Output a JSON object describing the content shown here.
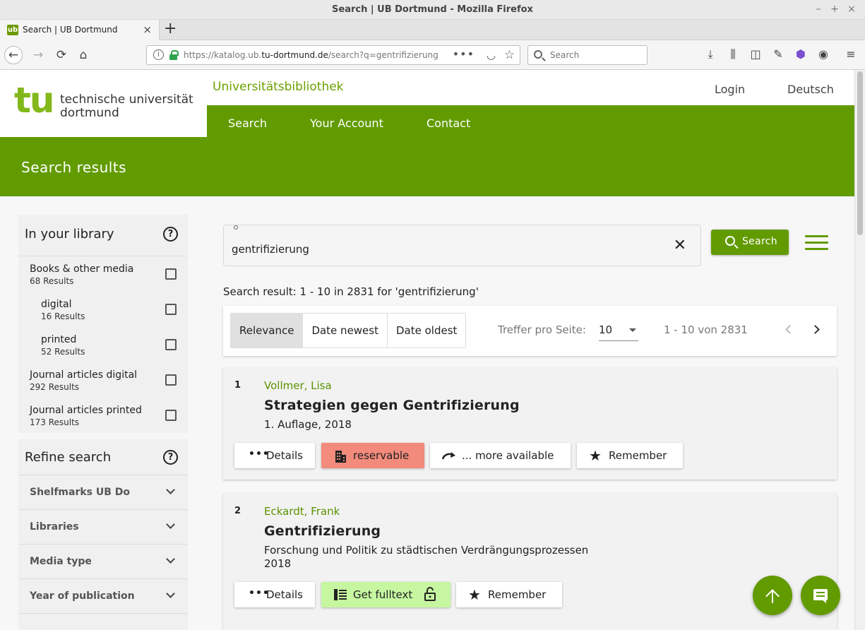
{
  "window": {
    "title": "Search | UB Dortmund - Mozilla Firefox",
    "controls": [
      "–",
      "+",
      "×"
    ]
  },
  "tab": {
    "favicon_text": "ub",
    "label": "Search | UB Dortmund",
    "close": "×",
    "new_tab": "+"
  },
  "urlbar": {
    "prefix": "https://katalog.ub.",
    "domain": "tu-dortmund.de",
    "suffix": "/search?q=gentrifizierung",
    "info": "i",
    "dots": "•••"
  },
  "browser_search": {
    "placeholder": "Search"
  },
  "site": {
    "logo_mark": "tu",
    "logo_line1": "technische universität",
    "logo_line2": "dortmund",
    "library_name": "Universitätsbibliothek",
    "login": "Login",
    "language": "Deutsch",
    "nav": [
      "Search",
      "Your Account",
      "Contact"
    ],
    "page_title": "Search results"
  },
  "sidebar": {
    "library_title": "In your library",
    "facets": [
      {
        "label": "Books & other media",
        "count": "68 Results"
      },
      {
        "label": "digital",
        "count": "16 Results"
      },
      {
        "label": "printed",
        "count": "52 Results"
      },
      {
        "label": "Journal articles digital",
        "count": "292 Results"
      },
      {
        "label": "Journal articles printed",
        "count": "173 Results"
      }
    ],
    "refine_title": "Refine search",
    "refine_items": [
      "Shelfmarks UB Do",
      "Libraries",
      "Media type",
      "Year of publication"
    ],
    "help": "?"
  },
  "search": {
    "query": "gentrifizierung",
    "button": "Search",
    "clear": "✕"
  },
  "result_summary": "Search result: 1 - 10 in 2831 for 'gentrifizierung'",
  "sort": {
    "options": [
      "Relevance",
      "Date newest",
      "Date oldest"
    ],
    "active": "Relevance",
    "per_page_label": "Treffer pro Seite:",
    "per_page_value": "10",
    "range": "1 - 10 von 2831"
  },
  "results": [
    {
      "num": "1",
      "author": "Vollmer, Lisa",
      "title": "Strategien gegen Gentrifizierung",
      "meta": [
        "1. Auflage, 2018"
      ],
      "actions": [
        "Details",
        "reservable",
        "... more available",
        "Remember"
      ]
    },
    {
      "num": "2",
      "author": "Eckardt, Frank",
      "title": "Gentrifizierung",
      "meta": [
        "Forschung und Politik zu städtischen Verdrängungsprozessen",
        "2018"
      ],
      "actions": [
        "Details",
        "Get fulltext",
        "Remember"
      ]
    }
  ],
  "colors": {
    "brand_green": "#629b00",
    "author_green": "#5a9300",
    "reservable": "#f28b7c",
    "fulltext": "#c6f7a0"
  }
}
